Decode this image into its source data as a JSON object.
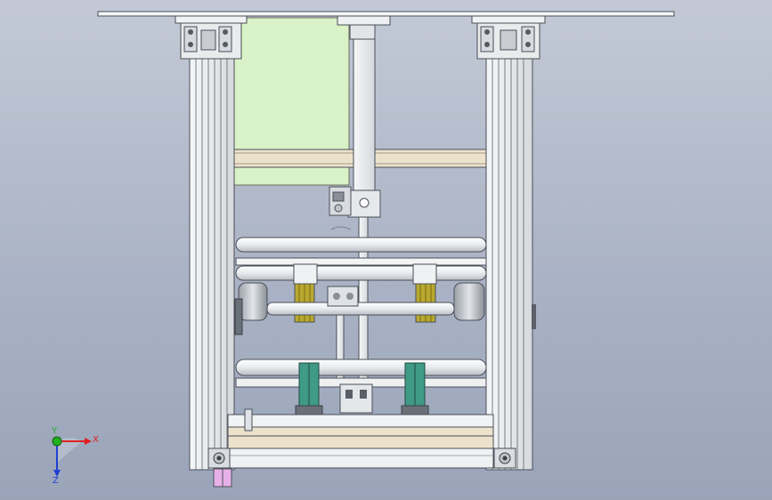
{
  "axis_triad": {
    "x_label": "X",
    "y_label": "Y",
    "z_label": "Z",
    "x_color": "#e02020",
    "y_color": "#20b020",
    "z_color": "#2040d0"
  },
  "colors": {
    "frame": "#eef0f0",
    "frame_edge": "#505560",
    "green_panel": "#d9f2c7",
    "wood": "#ece2cc",
    "teal": "#3f9a86",
    "olive": "#b8a830",
    "pink": "#e8b0e8",
    "gray_wheel": "#c8ccd0"
  }
}
